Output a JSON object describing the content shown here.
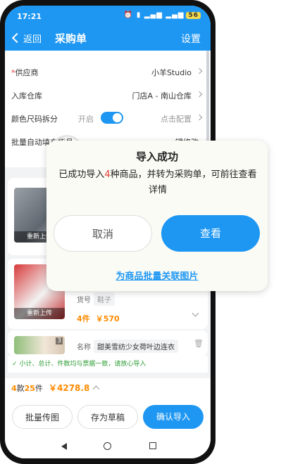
{
  "status": {
    "time": "17:21",
    "battery": "56"
  },
  "nav": {
    "back": "返回",
    "title": "采购单",
    "right": "设置"
  },
  "form": {
    "supplier_label": "供应商",
    "supplier_required": "*",
    "supplier_value": "小羊Studio",
    "warehouse_label": "入库仓库",
    "warehouse_value": "门店A - 南山仓库",
    "split_label": "颜色尺码拆分",
    "split_state": "开启",
    "split_config": "点击配置",
    "autofill_label": "批量自动填充货号",
    "autofill_value": "一键修改"
  },
  "cards": [
    {
      "caption": "重新上传"
    },
    {
      "caption": "重新上传",
      "sku_label": "货号",
      "sku_value": "鞋子",
      "qty": "4件",
      "price": "￥570"
    },
    {
      "badge": "3",
      "name_label": "名称",
      "name_value": "甜美雪纺少女荷叶边连衣"
    }
  ],
  "notice": "✓ 小计、总计、件数均与票据一致，请放心导入",
  "totals": {
    "kinds_num": "4",
    "kinds_unit": "款",
    "pieces_num": "25",
    "pieces_unit": "件",
    "amount": "￥4278.8"
  },
  "bottom": {
    "batch_upload": "批量传图",
    "save_draft": "存为草稿",
    "confirm": "确认导入"
  },
  "dialog": {
    "title": "导入成功",
    "msg_pre": "已成功导入",
    "msg_num": "4",
    "msg_post": "种商品，并转为采购单，可前往查看详情",
    "cancel": "取消",
    "view": "查看",
    "link": "为商品批量关联图片"
  },
  "colors": {
    "primary": "#1e97f3",
    "orange": "#ff8a00",
    "red": "#e53935",
    "green": "#2e9e35"
  }
}
